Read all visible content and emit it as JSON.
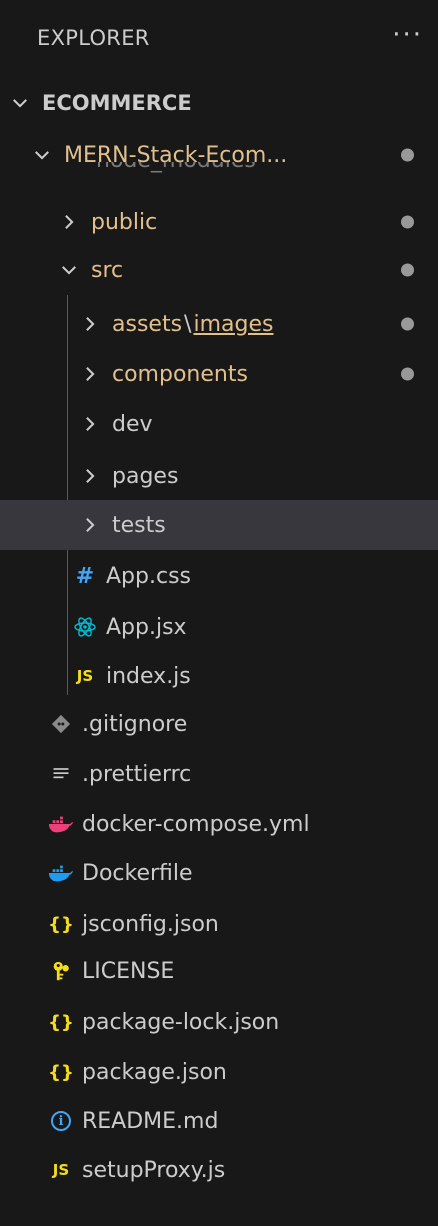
{
  "header": {
    "title": "EXPLORER",
    "more_icon": "more-icon"
  },
  "root": {
    "label": "ECOMMERCE"
  },
  "project": {
    "label": "MERN-Stack-Ecom..."
  },
  "ghost_label": "node_modules",
  "folders": {
    "public": "public",
    "src": "src",
    "assets": "assets",
    "images": "images",
    "components": "components",
    "dev": "dev",
    "pages": "pages",
    "tests": "tests"
  },
  "files": {
    "app_css": "App.css",
    "app_jsx": "App.jsx",
    "index_js": "index.js",
    "gitignore": ".gitignore",
    "prettierrc": ".prettierrc",
    "docker_compose": "docker-compose.yml",
    "dockerfile": "Dockerfile",
    "jsconfig": "jsconfig.json",
    "license": "LICENSE",
    "package_lock": "package-lock.json",
    "package_json": "package.json",
    "readme": "README.md",
    "setup_proxy": "setupProxy.js"
  },
  "icon_glyphs": {
    "css": "#",
    "js": "JS",
    "json": "{}",
    "info": "i"
  },
  "colors": {
    "background": "#181818",
    "selected_row": "#37373d",
    "modified_text": "#e2c08d",
    "css_icon": "#42a5f5",
    "react_icon": "#00bcd4",
    "js_icon": "#f5de19",
    "json_icon": "#f5de19",
    "docker_compose_icon": "#ec407a",
    "dockerfile_icon": "#1f9cef",
    "license_icon": "#f5de19",
    "readme_icon": "#42a5f5"
  }
}
